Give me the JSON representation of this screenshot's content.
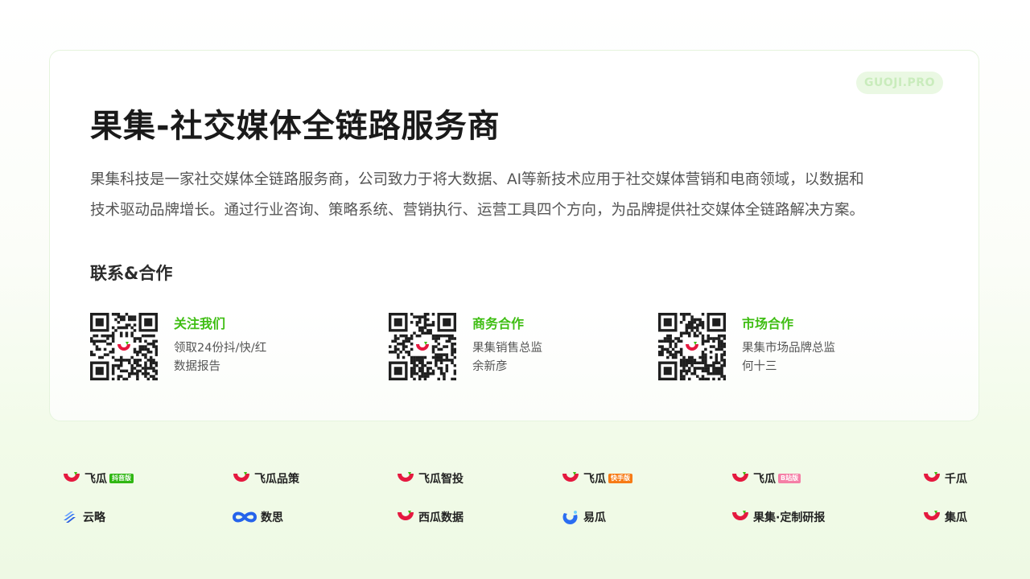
{
  "badge": "GUOJI.PRO",
  "title": "果集-社交媒体全链路服务商",
  "description": {
    "line1": "果集科技是一家社交媒体全链路服务商，公司致力于将大数据、AI等新技术应用于社交媒体营销和电商领域，以数据和",
    "line2": "技术驱动品牌增长。通过行业咨询、策略系统、营销执行、运营工具四个方向，为品牌提供社交媒体全链路解决方案。"
  },
  "contact_heading": "联系&合作",
  "contacts": [
    {
      "title": "关注我们",
      "line1": "领取24份抖/快/红",
      "line2": "数据报告"
    },
    {
      "title": "商务合作",
      "line1": "果集销售总监",
      "line2": "余新彦"
    },
    {
      "title": "市场合作",
      "line1": "果集市场品牌总监",
      "line2": "何十三"
    }
  ],
  "products": {
    "row1": [
      {
        "name": "飞瓜",
        "tag": "抖音版",
        "tag_color": "#2fb712",
        "icon": "feigua-logo-icon"
      },
      {
        "name": "飞瓜品策",
        "icon": "feigua-logo-icon"
      },
      {
        "name": "飞瓜智投",
        "icon": "feigua-logo-icon"
      },
      {
        "name": "飞瓜",
        "tag": "快手版",
        "tag_color": "#f77b16",
        "icon": "feigua-logo-icon"
      },
      {
        "name": "飞瓜",
        "tag": "B站版",
        "tag_color": "#f57fa6",
        "icon": "feigua-logo-icon"
      },
      {
        "name": "千瓜",
        "icon": "qiangua-logo-icon"
      }
    ],
    "row2": [
      {
        "name": "云略",
        "icon": "yunlue-logo-icon"
      },
      {
        "name": "数思",
        "icon": "shusi-logo-icon"
      },
      {
        "name": "西瓜数据",
        "icon": "xigua-logo-icon"
      },
      {
        "name": "易瓜",
        "icon": "yigua-logo-icon"
      },
      {
        "name": "果集·定制研报",
        "icon": "guoji-logo-icon"
      },
      {
        "name": "集瓜",
        "icon": "jigua-logo-icon"
      }
    ]
  },
  "colors": {
    "brand_green": "#3fbe13",
    "brand_red": "#e5193f",
    "card_border": "#e5f4dd"
  }
}
